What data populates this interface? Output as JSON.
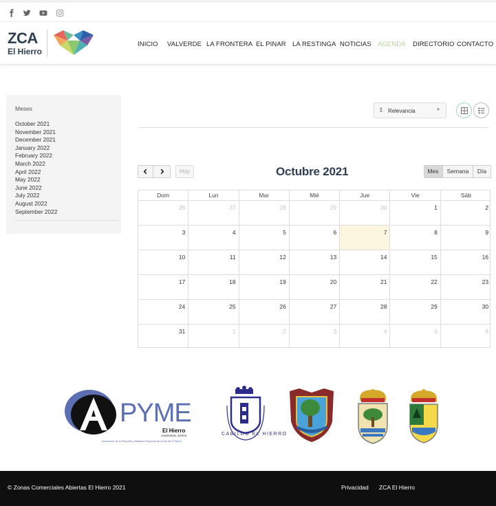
{
  "topbar": {
    "social_icons": [
      "facebook-icon",
      "twitter-icon",
      "youtube-icon",
      "instagram-icon"
    ]
  },
  "header": {
    "logo_line1": "ZCA",
    "logo_line2": "El Hierro",
    "nav": [
      "INICIO",
      "VALVERDE",
      "LA FRONTERA",
      "EL PINAR",
      "LA RESTINGA",
      "NOTICIAS",
      "AGENDA",
      "DIRECTORIO",
      "CONTACTO"
    ],
    "active_nav": "AGENDA",
    "active_color": "#b6d39a"
  },
  "sidebar": {
    "title": "Meses",
    "months": [
      "October 2021",
      "November 2021",
      "December 2021",
      "January 2022",
      "February 2022",
      "March 2022",
      "April 2022",
      "May 2022",
      "June 2022",
      "July 2022",
      "August 2022",
      "September 2022"
    ]
  },
  "toolbar": {
    "sort_label": "Relevancia",
    "sort_icon": "sort-icon",
    "view_icons": [
      "grid-view-icon",
      "list-view-icon"
    ]
  },
  "calendar": {
    "today_label": "Hoy",
    "title": "Octubre 2021",
    "views": [
      "Mes",
      "Semana",
      "Día"
    ],
    "active_view": "Mes",
    "weekdays": [
      "Dom",
      "Lun",
      "Mar",
      "Mié",
      "Jue",
      "Vie",
      "Sáb"
    ],
    "weeks": [
      [
        "26",
        "27",
        "28",
        "29",
        "30",
        "1",
        "2"
      ],
      [
        "3",
        "4",
        "5",
        "6",
        "7",
        "8",
        "9"
      ],
      [
        "10",
        "11",
        "12",
        "13",
        "14",
        "15",
        "16"
      ],
      [
        "17",
        "18",
        "19",
        "20",
        "21",
        "22",
        "23"
      ],
      [
        "24",
        "25",
        "26",
        "27",
        "28",
        "29",
        "30"
      ],
      [
        "31",
        "1",
        "2",
        "3",
        "4",
        "5",
        "6"
      ]
    ],
    "today_highlight": "#fcf6e1"
  },
  "partners": {
    "apyme_name": "PYME",
    "apyme_letter": "A",
    "apyme_sub1": "El Hierro",
    "apyme_sub2": "Avanzando Juntos",
    "apyme_caption": "Asociación de la Pequeña y Mediana Empresa de la Isla de El Hierro",
    "cabildo_text": "CABILDO EL HIERRO"
  },
  "footer": {
    "copyright": "© Zonas Comerciales Abiertas El Hierro 2021",
    "links": [
      "Privacidad",
      "ZCA El Hierro"
    ]
  }
}
